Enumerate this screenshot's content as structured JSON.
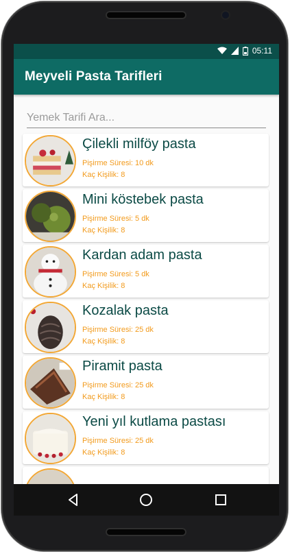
{
  "status": {
    "time": "05:11",
    "icons": [
      "wifi-icon",
      "signal-icon",
      "battery-icon"
    ]
  },
  "app": {
    "title": "Meyveli Pasta Tarifleri"
  },
  "search": {
    "placeholder": "Yemek Tarifi Ara..."
  },
  "recipes": [
    {
      "name": "Çilekli milföy pasta",
      "time_label": "Pişirme Süresi: 10 dk",
      "servings_label": "Kaç Kişilik: 8"
    },
    {
      "name": "Mini köstebek pasta",
      "time_label": "Pişirme Süresi: 5 dk",
      "servings_label": "Kaç Kişilik: 8"
    },
    {
      "name": "Kardan adam pasta",
      "time_label": "Pişirme Süresi: 5 dk",
      "servings_label": "Kaç Kişilik: 8"
    },
    {
      "name": "Kozalak pasta",
      "time_label": "Pişirme Süresi: 25 dk",
      "servings_label": "Kaç Kişilik: 8"
    },
    {
      "name": "Piramit pasta",
      "time_label": "Pişirme Süresi: 25 dk",
      "servings_label": "Kaç Kişilik: 8"
    },
    {
      "name": "Yeni yıl kutlama pastası",
      "time_label": "Pişirme Süresi: 25 dk",
      "servings_label": "Kaç Kişilik: 8"
    }
  ],
  "colors": {
    "primary": "#0e6b64",
    "status": "#0b4f4a",
    "accent": "#f29a1b",
    "text": "#0b4a45"
  },
  "navbar": {
    "buttons": [
      "back-icon",
      "home-icon",
      "recents-icon"
    ]
  }
}
